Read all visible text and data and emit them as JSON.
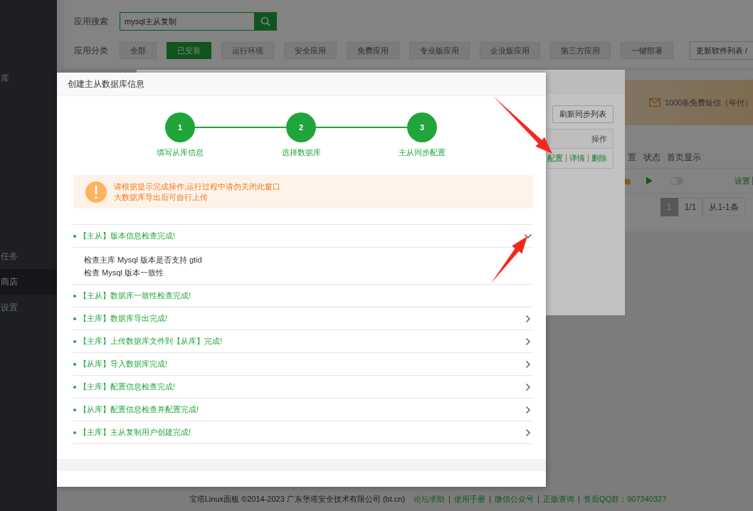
{
  "sidebar": {
    "items": [
      {
        "label": "库",
        "selected": false
      },
      {
        "label": "任务",
        "selected": false
      },
      {
        "label": "商店",
        "selected": true
      },
      {
        "label": "设置",
        "selected": false
      }
    ]
  },
  "search": {
    "label": "应用搜索",
    "value": "mysql主从复制"
  },
  "categories": {
    "label": "应用分类",
    "items": [
      {
        "label": "全部",
        "selected": false
      },
      {
        "label": "已安装",
        "selected": true
      },
      {
        "label": "运行环境",
        "selected": false
      },
      {
        "label": "安全应用",
        "selected": false
      },
      {
        "label": "免费应用",
        "selected": false
      },
      {
        "label": "专业版应用",
        "selected": false
      },
      {
        "label": "企业版应用",
        "selected": false
      },
      {
        "label": "第三方应用",
        "selected": false
      },
      {
        "label": "一键部署",
        "selected": false
      }
    ],
    "update_button": "更新软件列表 /"
  },
  "promo": {
    "text": "1000条免费短信（年付）"
  },
  "plugin_table": {
    "columns": [
      "置",
      "状态",
      "首页显示"
    ],
    "rows": [
      {
        "on": false,
        "action": "设置"
      }
    ]
  },
  "pagination": {
    "pages": [
      {
        "label": "1",
        "selected": true
      }
    ],
    "info": "1/1",
    "range": "从1-1条"
  },
  "sync_dialog": {
    "refresh_button": "刷新同步列表",
    "columns": [
      "操作"
    ],
    "actions": [
      "配置",
      "详情",
      "删除"
    ]
  },
  "dialog": {
    "title": "创建主从数据库信息",
    "steps": [
      {
        "number": "1",
        "label": "填写从库信息"
      },
      {
        "number": "2",
        "label": "选择数据库"
      },
      {
        "number": "3",
        "label": "主从同步配置"
      }
    ],
    "notice": [
      "请根据提示完成操作,运行过程中请勿关闭此窗口",
      "大数据库导出后可自行上传"
    ],
    "checks": [
      {
        "title": "【主从】版本信息检查完成!",
        "kind": "expanded",
        "details": [
          "检查主库 Mysql 版本是否支持 gtid",
          "检查 Mysql 版本一致性"
        ]
      },
      {
        "title": "【主从】数据库一致性检查完成!",
        "kind": "plain"
      },
      {
        "title": "【主库】数据库导出完成!",
        "kind": "collapsed"
      },
      {
        "title": "【主库】上传数据库文件到【从库】完成!",
        "kind": "collapsed"
      },
      {
        "title": "【从库】导入数据库完成!",
        "kind": "collapsed"
      },
      {
        "title": "【主库】配置信息检查完成!",
        "kind": "collapsed"
      },
      {
        "title": "【从库】配置信息检查并配置完成!",
        "kind": "collapsed"
      },
      {
        "title": "【主库】主从复制用户创建完成!",
        "kind": "collapsed"
      }
    ]
  },
  "footer": {
    "copyright": "宝塔Linux面板 ©2014-2023 广东堡塔安全技术有限公司 (bt.cn)",
    "links": [
      "论坛求助",
      "使用手册",
      "微信公众号",
      "正版查询",
      "售后QQ群：907340327"
    ]
  }
}
